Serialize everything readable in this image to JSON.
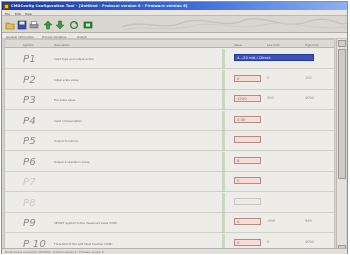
{
  "window": {
    "title": "CMDConfig Configuration Tool - [Untitled - Protocol version 6 - Firmware version 6]"
  },
  "menu": [
    "File",
    "Edit",
    "Help"
  ],
  "toolbar": {
    "buttons": [
      "open-icon",
      "save-icon",
      "print-icon",
      "upload-icon",
      "download-icon",
      "refresh-icon",
      "connect-icon"
    ]
  },
  "tabs": [
    "General Information",
    "Process Variables",
    "Output"
  ],
  "grid": {
    "columns": [
      "Symbol",
      "Description",
      "Value",
      "Low limit",
      "High limit"
    ],
    "rows": [
      {
        "symbol": "P1",
        "description": "Input type and output action",
        "value": "4...20 mA / Direct",
        "low": "",
        "high": "",
        "style": "blue"
      },
      {
        "symbol": "P2",
        "description": "Initial scale value",
        "value": "0",
        "low": "0",
        "high": "100",
        "style": "normal"
      },
      {
        "symbol": "P3",
        "description": "Full scale value",
        "value": "1200",
        "low": "300",
        "high": "4000",
        "style": "normal"
      },
      {
        "symbol": "P4",
        "description": "Input compensation",
        "value": "0.00",
        "low": "",
        "high": "",
        "style": "normal"
      },
      {
        "symbol": "P5",
        "description": "Output Functions",
        "value": "",
        "low": "",
        "high": "",
        "style": "normal"
      },
      {
        "symbol": "P6",
        "description": "Output 2 operation mode",
        "value": "8",
        "low": "",
        "high": "",
        "style": "normal"
      },
      {
        "symbol": "P7",
        "description": "",
        "value": "0",
        "low": "",
        "high": "",
        "style": "disabled"
      },
      {
        "symbol": "P8",
        "description": "",
        "value": "",
        "low": "",
        "high": "",
        "style": "disabled-empty"
      },
      {
        "symbol": "P9",
        "description": "SETSET applied to the measured value (OOP)",
        "value": "0",
        "low": "-999",
        "high": "999",
        "style": "normal"
      },
      {
        "symbol": "P 10",
        "description": "Threshold of the Soft Start function (OOP)",
        "value": "0",
        "low": "0",
        "high": "4000",
        "style": "normal"
      }
    ]
  },
  "status": "Model device connected: CDC1000 - Protocol version 6 - Firmware version 6",
  "colors": {
    "selection": "#3d51b8",
    "value_cell": "#f6dcd4",
    "titlebar": "#1a3aa5"
  }
}
